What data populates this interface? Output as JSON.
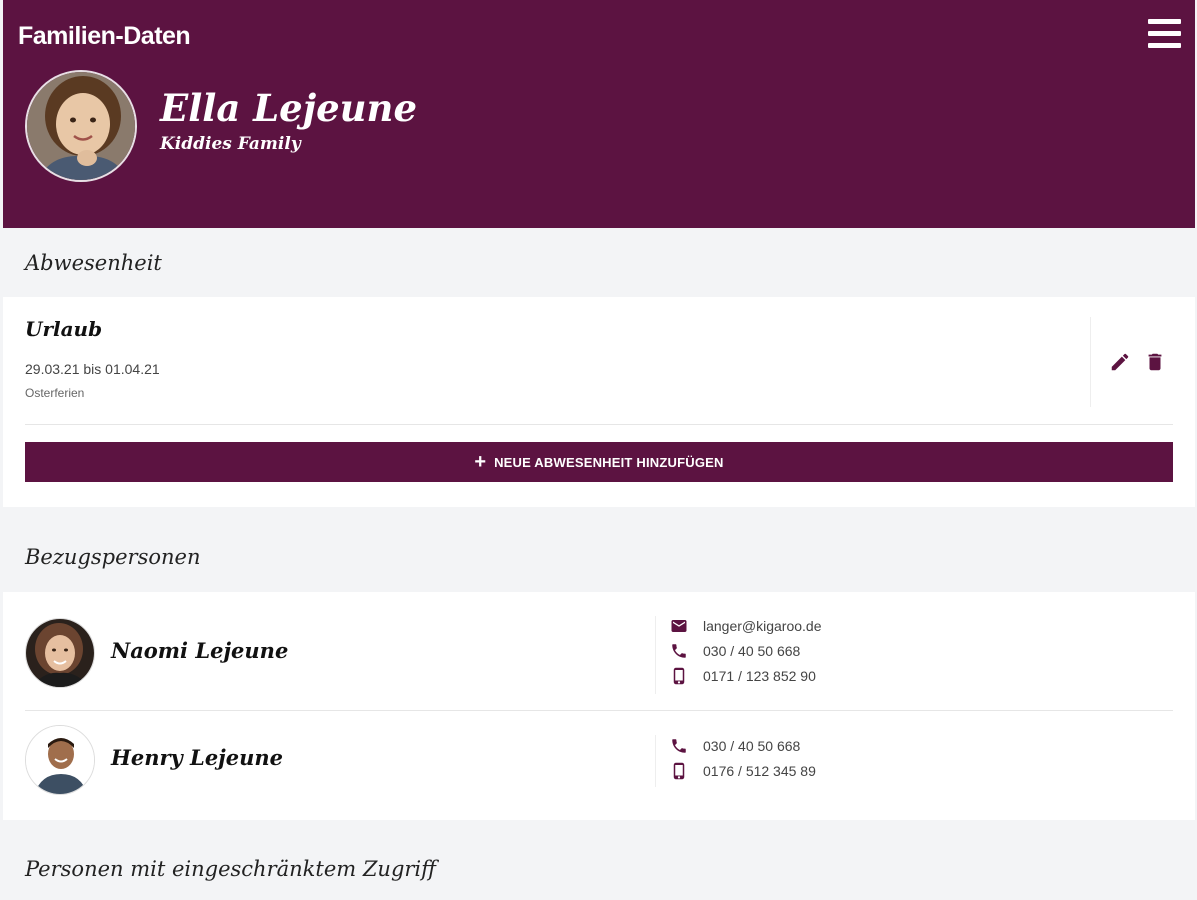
{
  "app": {
    "title": "Familien-Daten"
  },
  "profile": {
    "name": "Ella Lejeune",
    "group": "Kiddies Family"
  },
  "sections": {
    "absence": "Abwesenheit",
    "contacts": "Bezugspersonen",
    "restricted": "Personen mit eingeschränktem Zugriff"
  },
  "absence_item": {
    "title": "Urlaub",
    "dates": "29.03.21 bis 01.04.21",
    "note": "Osterferien"
  },
  "add_absence": {
    "icon": "+",
    "label": "NEUE ABWESENHEIT HINZUFÜGEN"
  },
  "persons": [
    {
      "name": "Naomi Lejeune",
      "contacts": [
        {
          "icon": "mail-icon",
          "value": "langer@kigaroo.de"
        },
        {
          "icon": "phone-icon",
          "value": "030 / 40 50 668"
        },
        {
          "icon": "mobile-icon",
          "value": "0171 / 123 852 90"
        }
      ]
    },
    {
      "name": "Henry Lejeune",
      "contacts": [
        {
          "icon": "phone-icon",
          "value": "030 / 40 50 668"
        },
        {
          "icon": "mobile-icon",
          "value": "0176 / 512 345 89"
        }
      ]
    }
  ],
  "colors": {
    "primary": "#5c1341",
    "background": "#f3f4f6",
    "card": "#ffffff"
  }
}
